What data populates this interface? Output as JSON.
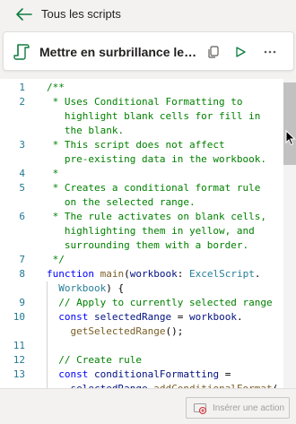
{
  "nav": {
    "back_label": "Tous les scripts"
  },
  "script": {
    "title": "Mettre en surbrillance les..."
  },
  "footer": {
    "insert_action_label": "Insérer une action"
  },
  "editor": {
    "line_numbers": [
      "1",
      "2",
      "",
      "",
      "3",
      "",
      "4",
      "5",
      "",
      "6",
      "",
      "",
      "7",
      "8",
      "",
      "9",
      "10",
      "",
      "11",
      "12",
      "13",
      ""
    ],
    "lines": [
      "/**",
      " * Uses Conditional Formatting to",
      "   highlight blank cells for fill in",
      "   the blank.",
      " * This script does not affect",
      "   pre-existing data in the workbook.",
      " *",
      " * Creates a conditional format rule",
      "   on the selected range.",
      " * The rule activates on blank cells,",
      "   highlighting them in yellow, and",
      "   surrounding them with a border.",
      " */",
      "function main(workbook: ExcelScript.",
      "  Workbook) {",
      "  // Apply to currently selected range",
      "  const selectedRange = workbook.",
      "    getSelectedRange();",
      "",
      "  // Create rule",
      "  const conditionalFormatting =",
      "    selectedRange.addConditionalFormat("
    ]
  }
}
